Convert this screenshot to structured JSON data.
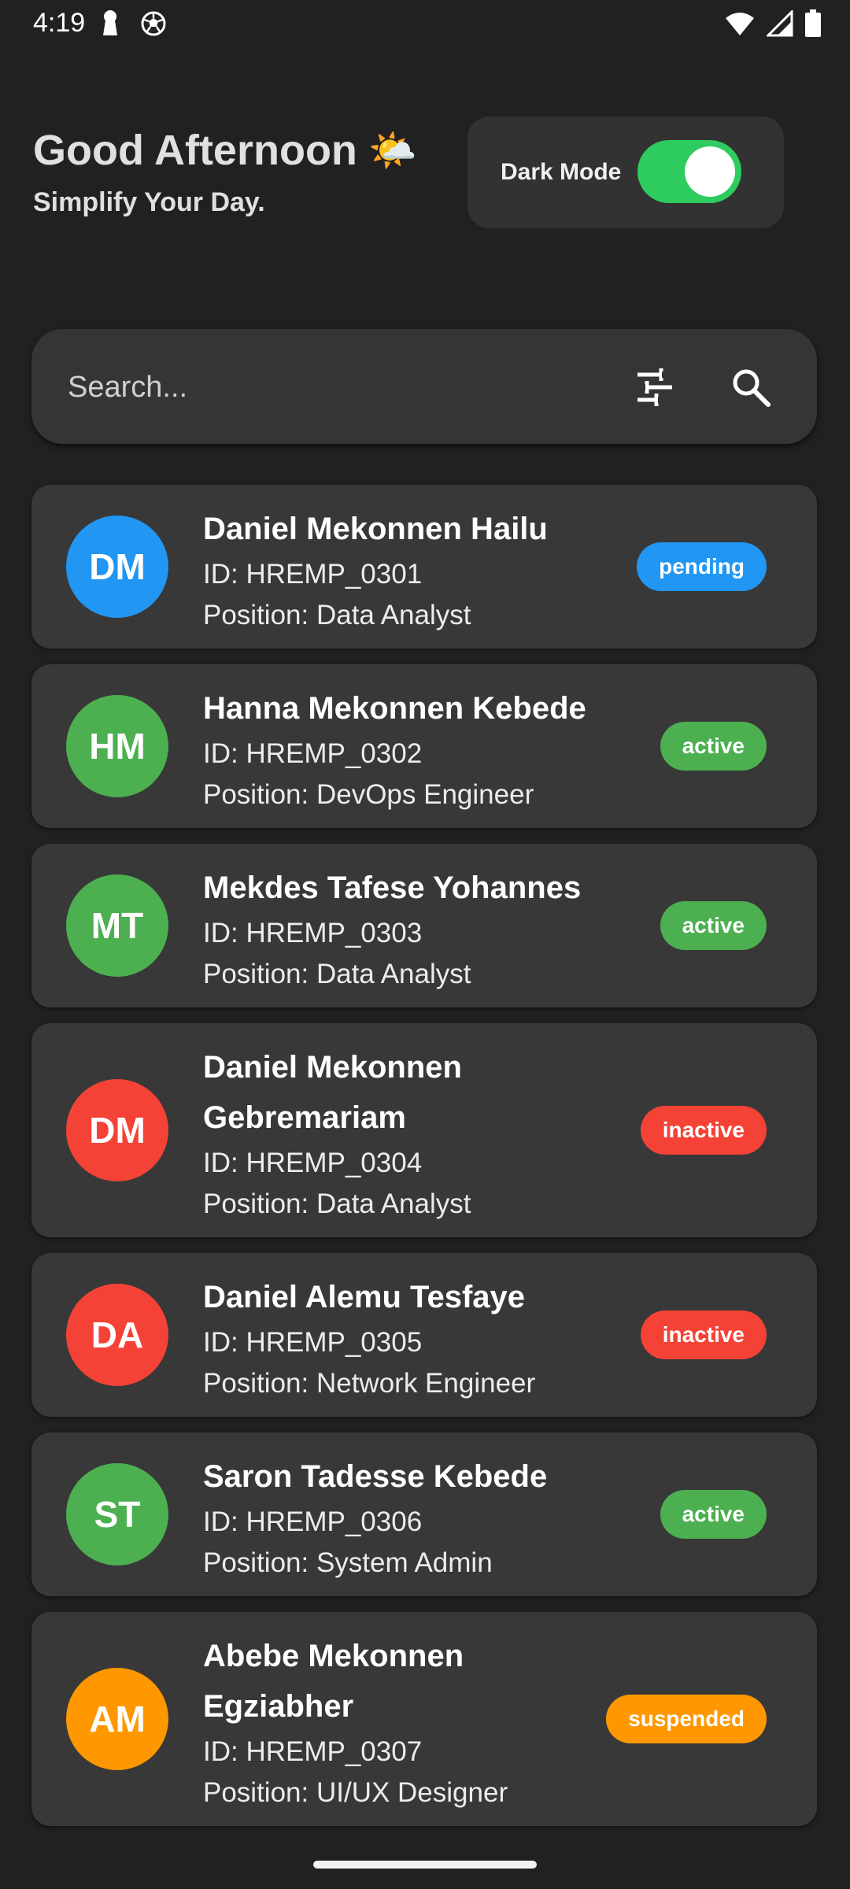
{
  "status_bar": {
    "time": "4:19",
    "left_icons": [
      "keyhole-icon",
      "soccer-ball-icon"
    ],
    "right_icons": [
      "wifi-icon",
      "cell-signal-icon",
      "battery-icon"
    ]
  },
  "header": {
    "greeting": "Good Afternoon",
    "greeting_emoji": "🌤️",
    "tagline": "Simplify Your Day."
  },
  "dark_mode": {
    "label": "Dark Mode",
    "enabled": true,
    "on_color": "#2ecc5e"
  },
  "search": {
    "placeholder": "Search...",
    "value": "",
    "filter_icon": "sliders-icon",
    "search_icon": "search-icon"
  },
  "status_colors": {
    "pending": "#2196F3",
    "active": "#4CAF50",
    "inactive": "#F44336",
    "suspended": "#FF9800"
  },
  "employees": [
    {
      "initials": "DM",
      "name": "Daniel Mekonnen Hailu",
      "id": "ID: HREMP_0301",
      "position": "Position: Data Analyst",
      "status": "pending",
      "avatar_color": "#2196F3",
      "badge_color": "#2196F3"
    },
    {
      "initials": "HM",
      "name": "Hanna Mekonnen Kebede",
      "id": "ID: HREMP_0302",
      "position": "Position: DevOps Engineer",
      "status": "active",
      "avatar_color": "#4CAF50",
      "badge_color": "#4CAF50"
    },
    {
      "initials": "MT",
      "name": "Mekdes Tafese Yohannes",
      "id": "ID: HREMP_0303",
      "position": "Position: Data Analyst",
      "status": "active",
      "avatar_color": "#4CAF50",
      "badge_color": "#4CAF50"
    },
    {
      "initials": "DM",
      "name": "Daniel Mekonnen Gebremariam",
      "id": "ID: HREMP_0304",
      "position": "Position: Data Analyst",
      "status": "inactive",
      "avatar_color": "#F44336",
      "badge_color": "#F44336"
    },
    {
      "initials": "DA",
      "name": "Daniel Alemu Tesfaye",
      "id": "ID: HREMP_0305",
      "position": "Position: Network Engineer",
      "status": "inactive",
      "avatar_color": "#F44336",
      "badge_color": "#F44336"
    },
    {
      "initials": "ST",
      "name": "Saron Tadesse Kebede",
      "id": "ID: HREMP_0306",
      "position": "Position: System Admin",
      "status": "active",
      "avatar_color": "#4CAF50",
      "badge_color": "#4CAF50"
    },
    {
      "initials": "AM",
      "name": "Abebe Mekonnen Egziabher",
      "id": "ID: HREMP_0307",
      "position": "Position: UI/UX Designer",
      "status": "suspended",
      "avatar_color": "#FF9800",
      "badge_color": "#FF9800"
    }
  ]
}
